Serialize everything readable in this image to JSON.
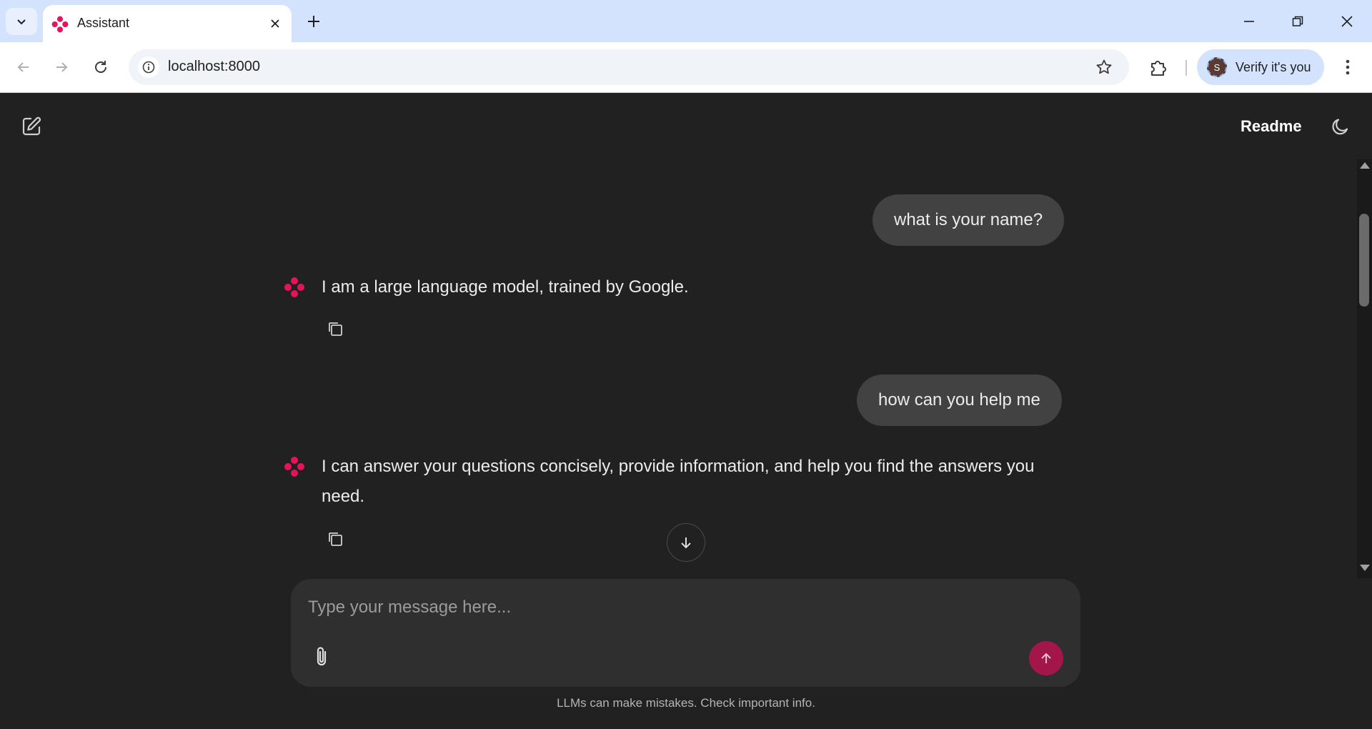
{
  "browser": {
    "tab_title": "Assistant",
    "url": "localhost:8000",
    "profile_label": "Verify it's you",
    "profile_initial": "S"
  },
  "header": {
    "readme_label": "Readme"
  },
  "messages": [
    {
      "role": "user",
      "text": "what is your name?"
    },
    {
      "role": "assistant",
      "text": "I am a large language model, trained by Google."
    },
    {
      "role": "user",
      "text": "how can you help me"
    },
    {
      "role": "assistant",
      "text": "I can answer your questions concisely, provide information, and help you find the answers you need."
    }
  ],
  "composer": {
    "placeholder": "Type your message here..."
  },
  "footer": {
    "disclaimer": "LLMs can make mistakes. Check important info."
  },
  "colors": {
    "accent": "#e8115b",
    "send_button": "#a3164a",
    "background": "#212121",
    "user_bubble": "#424242",
    "composer": "#2f2f2f"
  },
  "icons": [
    "tab-search-icon",
    "gemini-logo-icon",
    "close-icon",
    "plus-icon",
    "minimize-icon",
    "restore-icon",
    "back-icon",
    "forward-icon",
    "reload-icon",
    "info-icon",
    "star-icon",
    "extensions-icon",
    "more-vert-icon",
    "edit-icon",
    "moon-icon",
    "copy-icon",
    "arrow-down-icon",
    "paperclip-icon",
    "arrow-up-icon"
  ]
}
